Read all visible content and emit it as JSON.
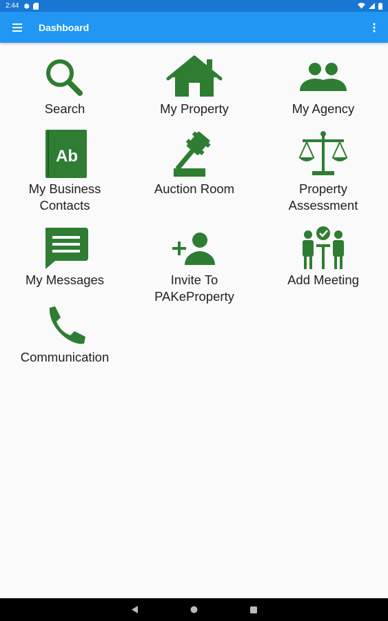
{
  "status_bar": {
    "time": "2:44"
  },
  "app_bar": {
    "title": "Dashboard"
  },
  "theme": {
    "accent": "#2e7d32",
    "app_bar": "#2196f3",
    "status_bar": "#1976d2"
  },
  "tiles": [
    {
      "label": "Search",
      "icon": "search-icon"
    },
    {
      "label": "My Property",
      "icon": "house-icon"
    },
    {
      "label": "My Agency",
      "icon": "group-icon"
    },
    {
      "label": "My Business\nContacts",
      "icon": "contacts-book-icon"
    },
    {
      "label": "Auction Room",
      "icon": "gavel-icon"
    },
    {
      "label": "Property\nAssessment",
      "icon": "scales-icon"
    },
    {
      "label": "My Messages",
      "icon": "message-icon"
    },
    {
      "label": "Invite To\nPAKeProperty",
      "icon": "add-person-icon"
    },
    {
      "label": "Add Meeting",
      "icon": "meeting-icon"
    },
    {
      "label": "Communication",
      "icon": "phone-icon"
    }
  ]
}
